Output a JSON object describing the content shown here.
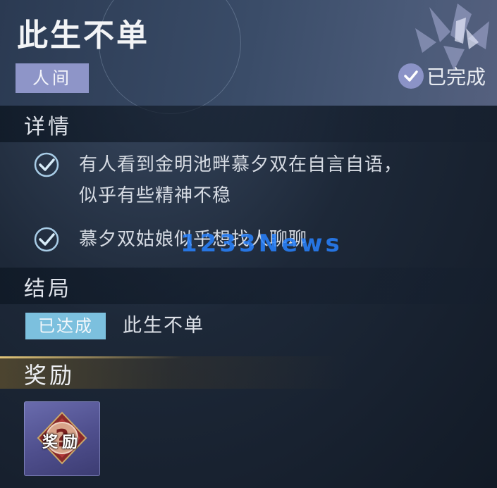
{
  "quest": {
    "title": "此生不单",
    "tag": "人间",
    "status": "已完成"
  },
  "details": {
    "heading": "详情",
    "items": [
      {
        "line1": "有人看到金明池畔慕夕双在自言自语，",
        "line2": "似乎有些精神不稳"
      },
      {
        "line1": "慕夕双姑娘似乎想找人聊聊",
        "line2": ""
      }
    ]
  },
  "ending": {
    "heading": "结局",
    "badge": "已达成",
    "name": "此生不单"
  },
  "reward": {
    "heading": "奖励",
    "item_label": "奖励"
  },
  "watermark": "1233News",
  "colors": {
    "tag_bg": "#8e95c8",
    "badge_bg": "#7cc0de",
    "reward_item_bg": "#5a5a9a",
    "watermark": "#2882ff"
  }
}
